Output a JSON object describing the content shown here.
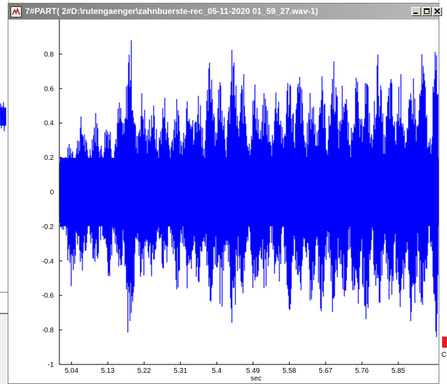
{
  "window": {
    "title": "7#PART( 2#D:\\rutengaenger\\zahnbuerste-rec_05-11-2020 01_59_27.wav-1)",
    "buttons": [
      "minimize",
      "maximize",
      "close"
    ]
  },
  "background": {
    "right_edge_char": "C"
  },
  "colors": {
    "waveform": "#0000ff",
    "titlebar": "#9a9a9a",
    "plot_bg": "#ffffff"
  },
  "chart_data": {
    "type": "line",
    "xlabel": "sec",
    "ylabel": "",
    "title": "",
    "xlim": [
      5.01,
      5.95
    ],
    "ylim": [
      -1,
      1
    ],
    "x_ticks": [
      5.04,
      5.13,
      5.22,
      5.31,
      5.4,
      5.49,
      5.58,
      5.67,
      5.76,
      5.85
    ],
    "x_tick_labels": [
      "5.04",
      "5.13",
      "5.22",
      "5.31",
      "5.4",
      "5.49",
      "5.58",
      "5.67",
      "5.76",
      "5.85"
    ],
    "y_ticks": [
      -1,
      -0.8,
      -0.6,
      -0.4,
      -0.2,
      0,
      0.2,
      0.4,
      0.6,
      0.8
    ],
    "y_tick_labels": [
      "-1",
      "-0.8",
      "-0.6",
      "-0.4",
      "-0.2",
      "0",
      "0.2",
      "0.4",
      "0.6",
      "0.8"
    ],
    "grid": false,
    "series": [
      {
        "envelope_peaks": [
          {
            "x": 5.04,
            "max": 0.3,
            "min": -0.55
          },
          {
            "x": 5.065,
            "max": 0.45,
            "min": -0.5
          },
          {
            "x": 5.1,
            "max": 0.48,
            "min": -0.45
          },
          {
            "x": 5.13,
            "max": 0.46,
            "min": -0.55
          },
          {
            "x": 5.16,
            "max": 0.55,
            "min": -0.45
          },
          {
            "x": 5.185,
            "max": 0.95,
            "min": -0.95
          },
          {
            "x": 5.215,
            "max": 0.6,
            "min": -0.6
          },
          {
            "x": 5.24,
            "max": 0.55,
            "min": -0.5
          },
          {
            "x": 5.27,
            "max": 0.58,
            "min": -0.48
          },
          {
            "x": 5.3,
            "max": 0.55,
            "min": -0.6
          },
          {
            "x": 5.33,
            "max": 0.7,
            "min": -0.6
          },
          {
            "x": 5.355,
            "max": 0.62,
            "min": -0.6
          },
          {
            "x": 5.385,
            "max": 0.83,
            "min": -0.7
          },
          {
            "x": 5.41,
            "max": 0.73,
            "min": -0.7
          },
          {
            "x": 5.44,
            "max": 0.86,
            "min": -0.82
          },
          {
            "x": 5.465,
            "max": 0.7,
            "min": -0.65
          },
          {
            "x": 5.495,
            "max": 0.65,
            "min": -0.65
          },
          {
            "x": 5.52,
            "max": 0.6,
            "min": -0.58
          },
          {
            "x": 5.55,
            "max": 0.68,
            "min": -0.6
          },
          {
            "x": 5.58,
            "max": 0.75,
            "min": -0.7
          },
          {
            "x": 5.605,
            "max": 0.72,
            "min": -0.68
          },
          {
            "x": 5.635,
            "max": 0.62,
            "min": -0.75
          },
          {
            "x": 5.66,
            "max": 0.7,
            "min": -0.7
          },
          {
            "x": 5.69,
            "max": 0.82,
            "min": -0.75
          },
          {
            "x": 5.715,
            "max": 0.7,
            "min": -0.65
          },
          {
            "x": 5.745,
            "max": 0.7,
            "min": -0.8
          },
          {
            "x": 5.77,
            "max": 0.72,
            "min": -0.78
          },
          {
            "x": 5.8,
            "max": 0.82,
            "min": -0.78
          },
          {
            "x": 5.83,
            "max": 0.7,
            "min": -0.72
          },
          {
            "x": 5.855,
            "max": 0.7,
            "min": -0.85
          },
          {
            "x": 5.885,
            "max": 0.72,
            "min": -0.92
          },
          {
            "x": 5.91,
            "max": 0.82,
            "min": -0.75
          },
          {
            "x": 5.945,
            "max": 0.9,
            "min": -0.85
          }
        ],
        "trough_level": 0.22
      }
    ]
  }
}
